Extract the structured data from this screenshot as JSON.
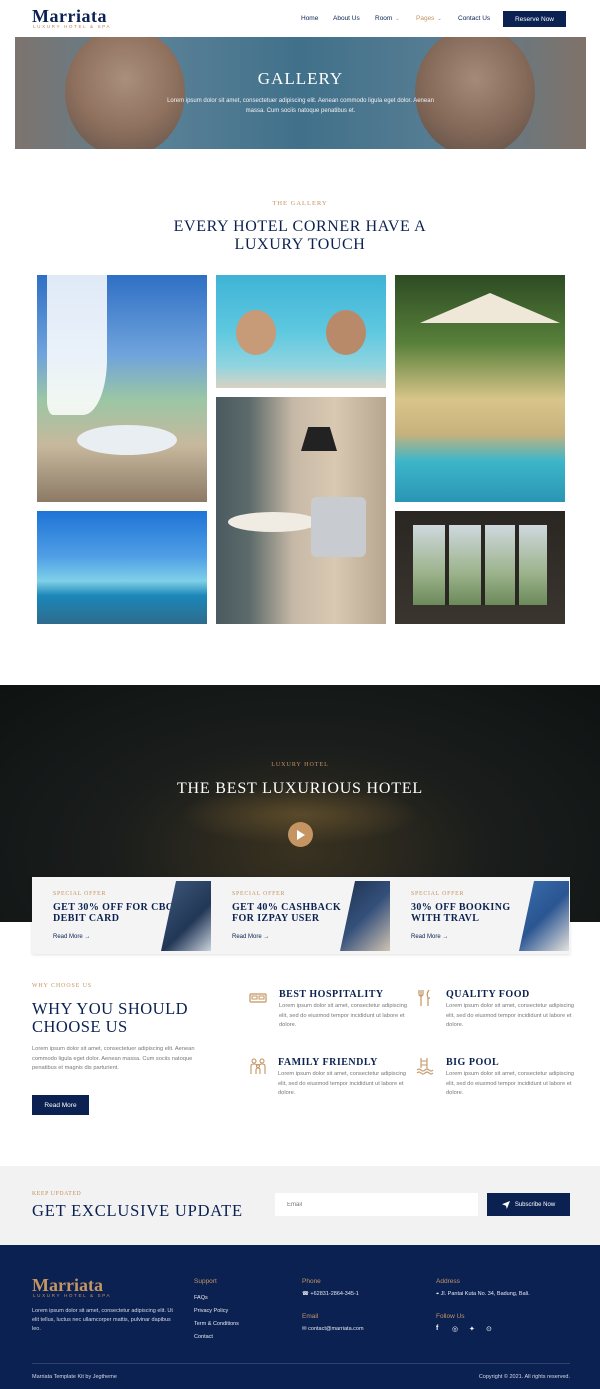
{
  "brand": {
    "name": "Marriata",
    "tagline": "LUXURY HOTEL & SPA"
  },
  "nav": {
    "items": [
      {
        "label": "Home"
      },
      {
        "label": "About Us"
      },
      {
        "label": "Room"
      },
      {
        "label": "Pages"
      },
      {
        "label": "Contact Us"
      }
    ],
    "reserve_label": "Reserve Now"
  },
  "hero": {
    "title": "GALLERY",
    "description": "Lorem ipsum dolor sit amet, consectetuer adipiscing elit. Aenean commodo ligula eget dolor. Aenean massa. Cum sociis natoque penatibus et."
  },
  "gallery": {
    "kicker": "THE GALLERY",
    "title": "EVERY HOTEL CORNER HAVE A LUXURY TOUCH"
  },
  "video": {
    "kicker": "LUXURY HOTEL",
    "title": "THE BEST LUXURIOUS HOTEL"
  },
  "offers": [
    {
      "kicker": "SPECIAL OFFER",
      "title": "GET 30% OFF FOR CBC DEBIT CARD",
      "link": "Read More"
    },
    {
      "kicker": "SPECIAL OFFER",
      "title": "GET 40% CASHBACK FOR IZPAY USER",
      "link": "Read More"
    },
    {
      "kicker": "SPECIAL OFFER",
      "title": "30% OFF BOOKING WITH TRAVL",
      "link": "Read More"
    }
  ],
  "why": {
    "kicker": "WHY CHOOSE US",
    "title": "WHY YOU SHOULD CHOOSE US",
    "description": "Lorem ipsum dolor sit amet, consectetuer adipiscing elit. Aenean commodo ligula eget dolor. Aenean massa. Cum sociis natoque penatibus et magnis dis parturient.",
    "button": "Read More",
    "features": [
      {
        "title": "BEST HOSPITALITY",
        "desc": "Lorem ipsum dolor sit amet, consectetur adipiscing elit, sed do eiusmod tempor incididunt ut labore et dolore."
      },
      {
        "title": "QUALITY FOOD",
        "desc": "Lorem ipsum dolor sit amet, consectetur adipiscing elit, sed do eiusmod tempor incididunt ut labore et dolore."
      },
      {
        "title": "FAMILY FRIENDLY",
        "desc": "Lorem ipsum dolor sit amet, consectetur adipiscing elit, sed do eiusmod tempor incididunt ut labore et dolore."
      },
      {
        "title": "BIG POOL",
        "desc": "Lorem ipsum dolor sit amet, consectetur adipiscing elit, sed do eiusmod tempor incididunt ut labore et dolore."
      }
    ]
  },
  "newsletter": {
    "kicker": "KEEP UPDATED",
    "title": "GET EXCLUSIVE UPDATE",
    "placeholder": "Email",
    "button": "Subscribe Now"
  },
  "footer": {
    "description": "Lorem ipsum dolor sit amet, consectetur adipiscing elit. Ut elit tellus, luctus nec ullamcorper mattis, pulvinar dapibus leo.",
    "support_head": "Support",
    "support_links": [
      "FAQs",
      "Privacy Policy",
      "Term & Conditions",
      "Contact"
    ],
    "phone_head": "Phone",
    "phone": "+62831-2864-345-1",
    "email_head": "Email",
    "email": "contact@marriata.com",
    "address_head": "Address",
    "address": "Jl. Pantai Kuta No. 34, Badung, Bali.",
    "follow_head": "Follow Us",
    "credit": "Marriata Template Kit by Jegtheme",
    "copyright": "Copyright © 2021. All rights reserved."
  },
  "colors": {
    "navy": "#0b2152",
    "gold": "#c49462"
  }
}
